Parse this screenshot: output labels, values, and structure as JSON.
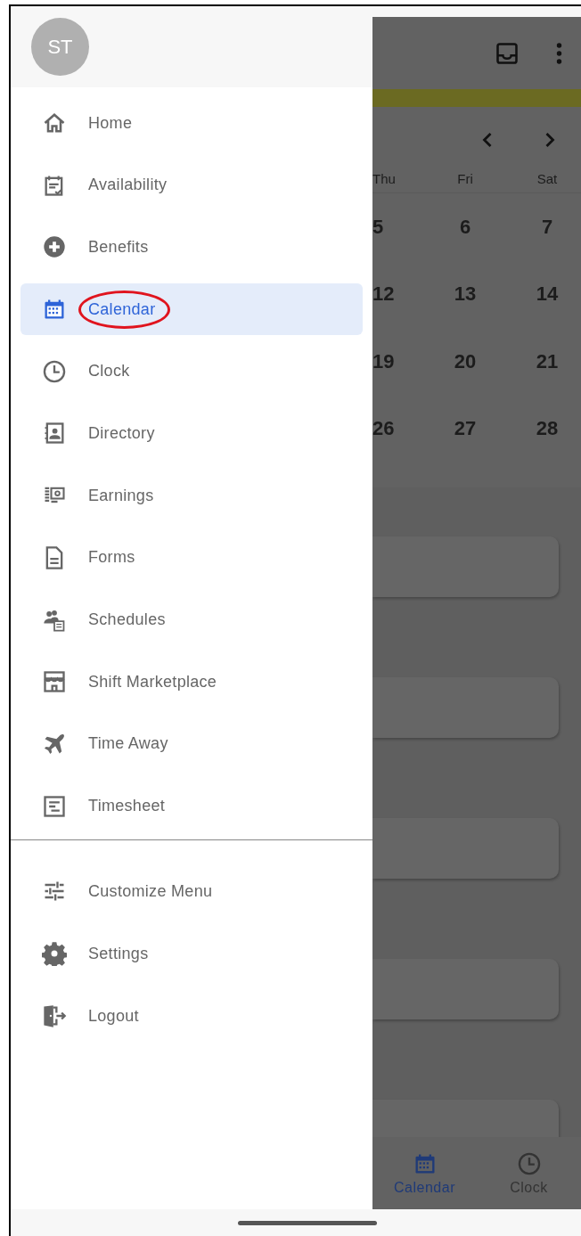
{
  "drawer": {
    "avatar": "ST",
    "items": [
      {
        "label": "Home",
        "selected": false,
        "circled": false
      },
      {
        "label": "Availability",
        "selected": false,
        "circled": false
      },
      {
        "label": "Benefits",
        "selected": false,
        "circled": false
      },
      {
        "label": "Calendar",
        "selected": true,
        "circled": true
      },
      {
        "label": "Clock",
        "selected": false,
        "circled": false
      },
      {
        "label": "Directory",
        "selected": false,
        "circled": false
      },
      {
        "label": "Earnings",
        "selected": false,
        "circled": false
      },
      {
        "label": "Forms",
        "selected": false,
        "circled": false
      },
      {
        "label": "Schedules",
        "selected": false,
        "circled": false
      },
      {
        "label": "Shift Marketplace",
        "selected": false,
        "circled": false
      },
      {
        "label": "Time Away",
        "selected": false,
        "circled": false
      },
      {
        "label": "Timesheet",
        "selected": false,
        "circled": false
      }
    ],
    "footer_items": [
      {
        "label": "Customize Menu"
      },
      {
        "label": "Settings"
      },
      {
        "label": "Logout"
      }
    ]
  },
  "calendar": {
    "weekdays": [
      "Thu",
      "Fri",
      "Sat"
    ],
    "weeks": [
      [
        "5",
        "6",
        "7"
      ],
      [
        "12",
        "13",
        "14"
      ],
      [
        "19",
        "20",
        "21"
      ],
      [
        "26",
        "27",
        "28"
      ]
    ]
  },
  "bottom_nav": [
    {
      "label": "Calendar",
      "selected": true
    },
    {
      "label": "Clock",
      "selected": false
    }
  ]
}
